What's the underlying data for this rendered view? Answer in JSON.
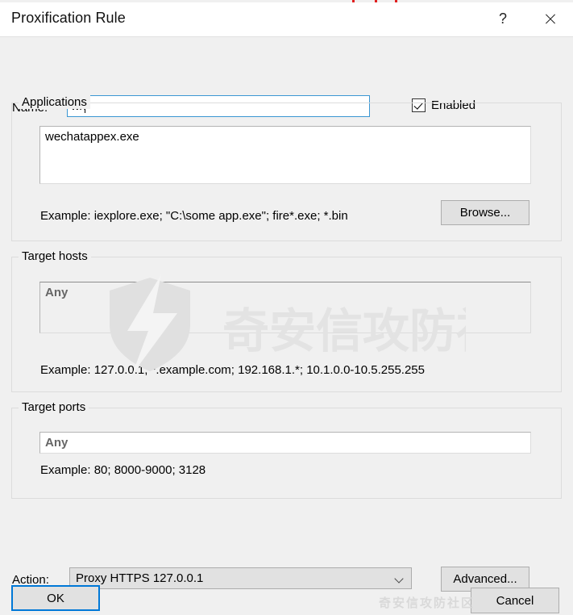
{
  "window": {
    "title": "Proxification Rule",
    "help_glyph": "?",
    "close_glyph": "✕"
  },
  "name_row": {
    "label": "Name:",
    "value": "wx",
    "placeholder": "",
    "enabled_label": "Enabled",
    "enabled_checked": true
  },
  "applications": {
    "group_title": "Applications",
    "value": "wechatappex.exe",
    "example": "Example: iexplore.exe; \"C:\\some app.exe\"; fire*.exe; *.bin",
    "browse_label": "Browse..."
  },
  "target_hosts": {
    "group_title": "Target hosts",
    "value": "Any",
    "example": "Example: 127.0.0.1; *.example.com; 192.168.1.*; 10.1.0.0-10.5.255.255"
  },
  "target_ports": {
    "group_title": "Target ports",
    "value": "Any",
    "example": "Example: 80; 8000-9000; 3128"
  },
  "action_row": {
    "label": "Action:",
    "selected": "Proxy HTTPS 127.0.0.1",
    "advanced_label": "Advanced..."
  },
  "footer": {
    "ok_label": "OK",
    "cancel_label": "Cancel"
  },
  "watermark": {
    "text": "奇安信攻防社区",
    "color": "#e0e0e0",
    "bottom_text": "奇安信攻防社区"
  },
  "top_ticks": {
    "color": "#e02020",
    "positions": [
      437,
      465,
      490
    ]
  }
}
